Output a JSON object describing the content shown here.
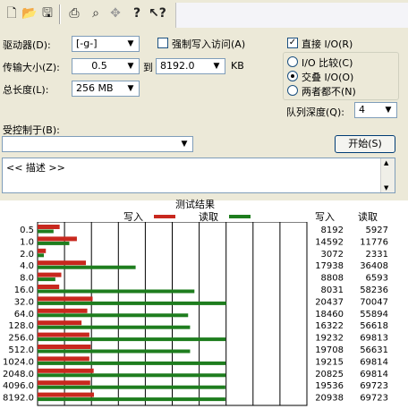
{
  "toolbar": {
    "icons": [
      "new-file-icon",
      "open-folder-icon",
      "save-icon",
      "print-icon",
      "print-preview-icon",
      "move-icon",
      "help-icon",
      "whats-this-help-icon"
    ]
  },
  "drive": {
    "label": "驱动器(D):",
    "value": "[-g-]"
  },
  "force_write": {
    "label": "强制写入访问(A)",
    "checked": false
  },
  "direct_io": {
    "label": "直接 I/O(R)",
    "checked": true
  },
  "transfer_size": {
    "label": "传输大小(Z):",
    "from": "0.5",
    "to_label": "到",
    "to": "8192.0",
    "unit": "KB"
  },
  "io_mode": {
    "options": [
      {
        "label": "I/O 比较(C)",
        "selected": false
      },
      {
        "label": "交叠 I/O(O)",
        "selected": true
      },
      {
        "label": "两者都不(N)",
        "selected": false
      }
    ]
  },
  "total_length": {
    "label": "总长度(L):",
    "value": "256 MB"
  },
  "queue_depth": {
    "label": "队列深度(Q):",
    "value": "4"
  },
  "controlled_by": {
    "label": "受控制于(B):",
    "value": ""
  },
  "start_button": "开始(S)",
  "description": "<< 描述 >>",
  "results": {
    "title": "测试结果",
    "legend_write": "写入",
    "legend_read": "读取",
    "col_write": "写入",
    "col_read": "读取",
    "colors": {
      "write": "#c8281e",
      "read": "#1e7d1e"
    }
  },
  "chart_data": {
    "type": "bar",
    "orientation": "horizontal",
    "categories": [
      "0.5",
      "1.0",
      "2.0",
      "4.0",
      "8.0",
      "16.0",
      "32.0",
      "64.0",
      "128.0",
      "256.0",
      "512.0",
      "1024.0",
      "2048.0",
      "4096.0",
      "8192.0"
    ],
    "series": [
      {
        "name": "写入",
        "values": [
          8192,
          14592,
          3072,
          17938,
          8808,
          8031,
          20437,
          18460,
          16322,
          19232,
          19708,
          19215,
          20825,
          19536,
          20938
        ]
      },
      {
        "name": "读取",
        "values": [
          5927,
          11776,
          2331,
          36408,
          6593,
          58236,
          70047,
          55894,
          56618,
          69813,
          56631,
          69814,
          69814,
          69723,
          69723
        ]
      }
    ],
    "xlim": [
      0,
      100000
    ],
    "grid": true
  }
}
